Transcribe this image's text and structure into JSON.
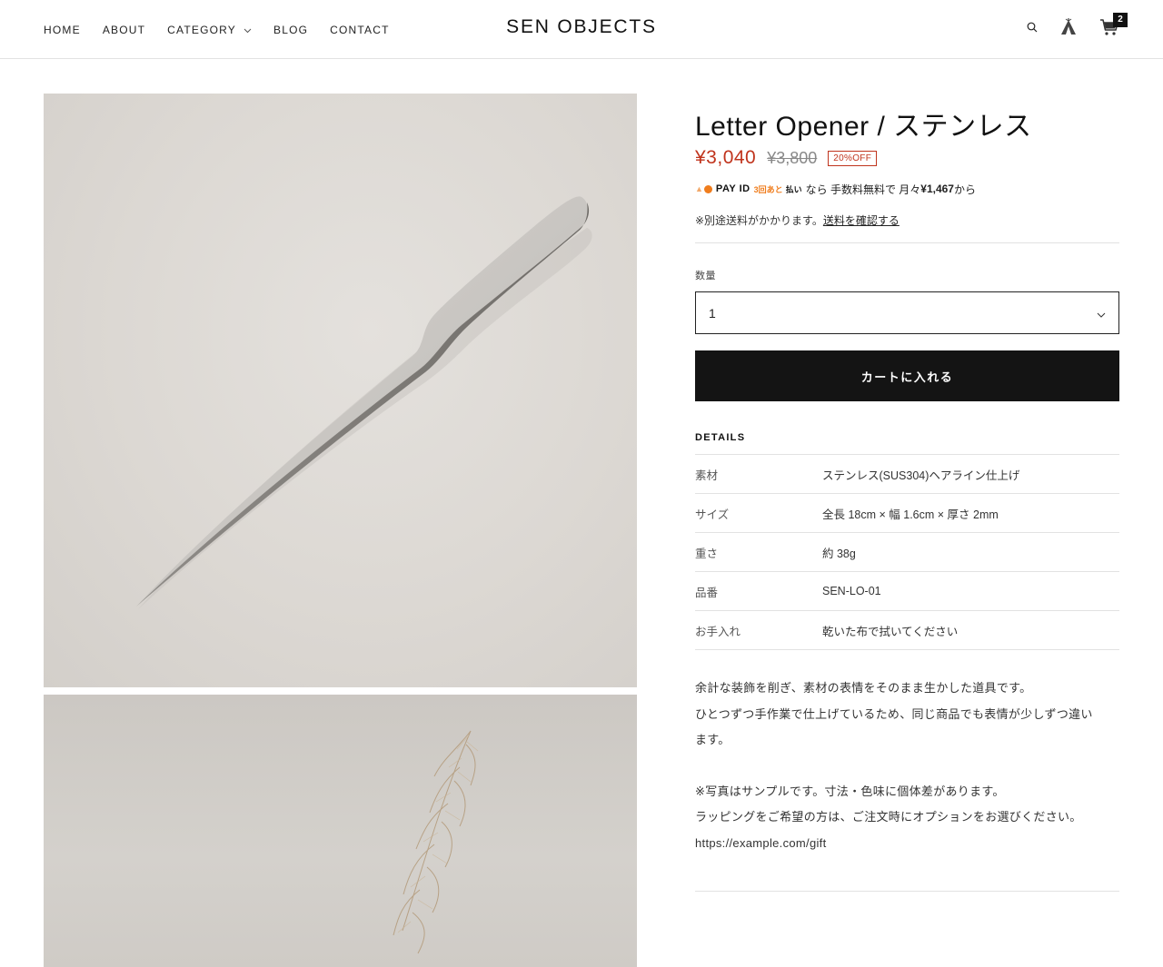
{
  "header": {
    "nav": [
      {
        "label": "HOME"
      },
      {
        "label": "ABOUT"
      },
      {
        "label": "CATEGORY"
      },
      {
        "label": "BLOG"
      },
      {
        "label": "CONTACT"
      }
    ],
    "logo": "SEN OBJECTS",
    "icons": [
      "search-icon",
      "account-icon",
      "cart-icon"
    ],
    "cart_count": "2"
  },
  "product": {
    "title": "Letter Opener / ステンレス",
    "price": "¥3,040",
    "compare_price": "¥3,800",
    "discount_badge": "20%OFF",
    "payid": {
      "brand": "PAY ID",
      "brand_sub": "3回あと",
      "brand_sub2": "払い",
      "text_pre": "なら 手数料無料で 月々",
      "amount": "¥1,467",
      "text_post": "から"
    },
    "shipping_note": "※別途送料がかかります。",
    "shipping_link": "送料を確認する",
    "quantity_label": "数量",
    "quantity_value": "1",
    "add_to_cart": "カートに入れる",
    "details_title": "DETAILS",
    "details": [
      {
        "key": "素材",
        "value": "ステンレス(SUS304)ヘアライン仕上げ"
      },
      {
        "key": "サイズ",
        "value": "全長 18cm × 幅 1.6cm × 厚さ 2mm"
      },
      {
        "key": "重さ",
        "value": "約 38g"
      },
      {
        "key": "品番",
        "value": "SEN-LO-01"
      },
      {
        "key": "お手入れ",
        "value": "乾いた布で拭いてください"
      }
    ],
    "description": [
      "余計な装飾を削ぎ、素材の表情をそのまま生かした道具です。",
      "ひとつずつ手作業で仕上げているため、同じ商品でも表情が少しずつ違い",
      "ます。",
      "",
      "※写真はサンプルです。寸法・色味に個体差があります。",
      "ラッピングをご希望の方は、ご注文時にオプションをお選びください。",
      "https://example.com/gift"
    ]
  },
  "colors": {
    "accent_red": "#c0341d",
    "button_dark": "#141414",
    "payid_orange": "#f07d1d"
  }
}
